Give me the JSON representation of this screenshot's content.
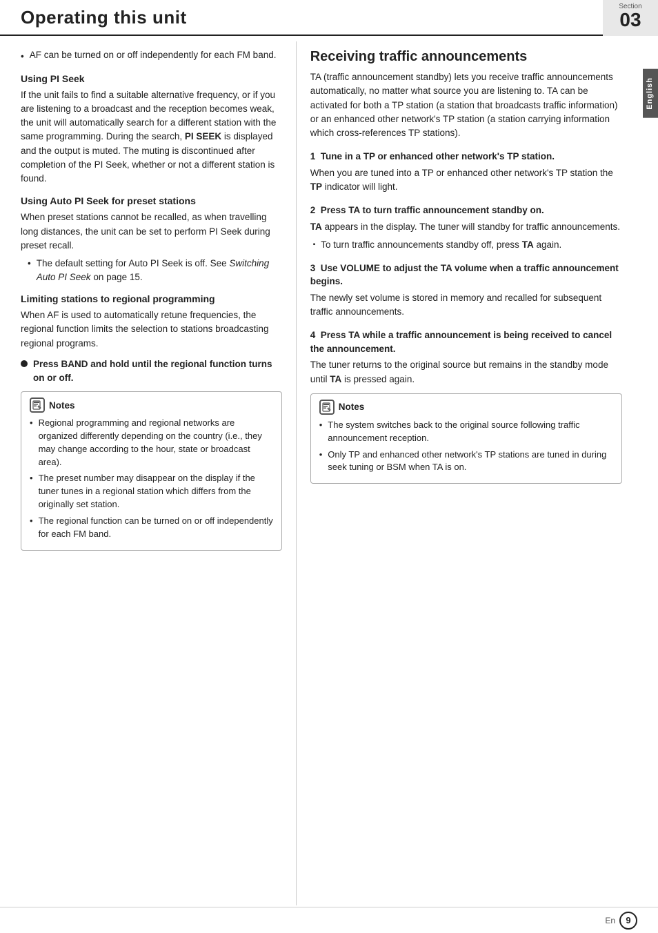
{
  "header": {
    "title": "Operating this unit",
    "section_label": "Section",
    "section_number": "03"
  },
  "english_tab": "English",
  "left_col": {
    "intro_bullet": "AF can be turned on or off independently for each FM band.",
    "using_pi_seek": {
      "heading": "Using PI Seek",
      "body": "If the unit fails to find a suitable alternative frequency, or if you are listening to a broadcast and the reception becomes weak, the unit will automatically search for a different station with the same programming. During the search,",
      "pi_seek_bold": "PI SEEK",
      "body2": "is displayed and the output is muted. The muting is discontinued after completion of the PI Seek, whether or not a different station is found."
    },
    "auto_pi_seek": {
      "heading": "Using Auto PI Seek for preset stations",
      "body": "When preset stations cannot be recalled, as when travelling long distances, the unit can be set to perform PI Seek during preset recall.",
      "bullet": "The default setting for Auto PI Seek is off. See",
      "bullet_italic": "Switching Auto PI Seek",
      "bullet2": "on page 15."
    },
    "limiting_stations": {
      "heading": "Limiting stations to regional programming",
      "body": "When AF is used to automatically retune frequencies, the regional function limits the selection to stations broadcasting regional programs.",
      "bold_bullet": "Press BAND and hold until the regional function turns on or off."
    },
    "notes": {
      "title": "Notes",
      "items": [
        "Regional programming and regional networks are organized differently depending on the country (i.e., they may change according to the hour, state or broadcast area).",
        "The preset number may disappear on the display if the tuner tunes in a regional station which differs from the originally set station.",
        "The regional function can be turned on or off independently for each FM band."
      ]
    }
  },
  "right_col": {
    "main_heading": "Receiving traffic announcements",
    "intro": "TA (traffic announcement standby) lets you receive traffic announcements automatically, no matter what source you are listening to. TA can be activated for both a TP station (a station that broadcasts traffic information) or an enhanced other network's TP station (a station carrying information which cross-references TP stations).",
    "steps": [
      {
        "number": "1",
        "heading": "Tune in a TP or enhanced other network's TP station.",
        "body": "When you are tuned into a TP or enhanced other network's TP station the",
        "bold_word": "TP",
        "body2": "indicator will light."
      },
      {
        "number": "2",
        "heading": "Press TA to turn traffic announcement standby on.",
        "bold_start": "TA",
        "body": "appears in the display. The tuner will standby for traffic announcements.",
        "sq_bullet": "To turn traffic announcements standby off, press",
        "sq_bold": "TA",
        "sq_end": "again."
      },
      {
        "number": "3",
        "heading": "Use VOLUME to adjust the TA volume when a traffic announcement begins.",
        "body": "The newly set volume is stored in memory and recalled for subsequent traffic announcements."
      },
      {
        "number": "4",
        "heading": "Press TA while a traffic announcement is being received to cancel the announcement.",
        "body": "The tuner returns to the original source but remains in the standby mode until",
        "bold_word": "TA",
        "body2": "is pressed again."
      }
    ],
    "notes": {
      "title": "Notes",
      "items": [
        "The system switches back to the original source following traffic announcement reception.",
        "Only TP and enhanced other network's TP stations are tuned in during seek tuning or BSM when TA is on."
      ]
    }
  },
  "footer": {
    "en_label": "En",
    "page_number": "9"
  }
}
